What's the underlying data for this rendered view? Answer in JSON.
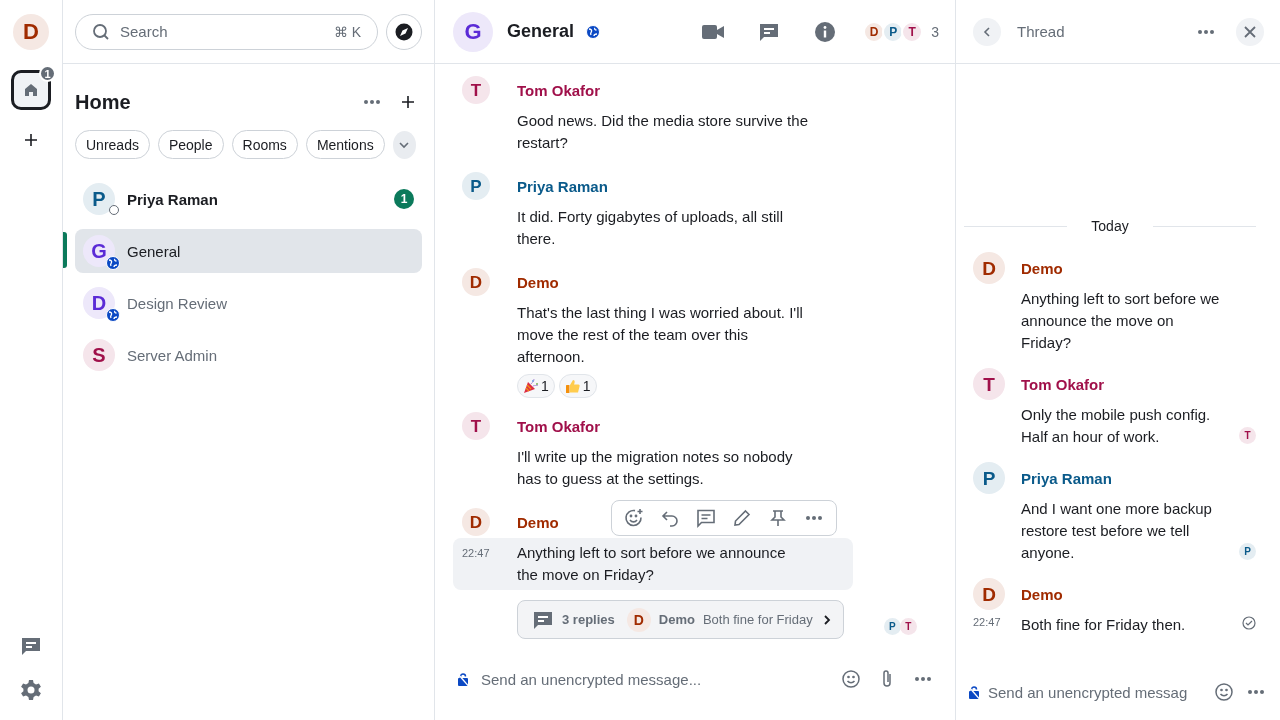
{
  "spaces": {
    "user": {
      "initial": "D",
      "color": "#a02b00"
    },
    "home": {
      "badge": "1",
      "selected": true
    }
  },
  "room_list": {
    "search": {
      "placeholder": "Search",
      "shortcut": "⌘ K"
    },
    "title": "Home",
    "filters": [
      {
        "label": "Unreads",
        "selected": false
      },
      {
        "label": "People",
        "selected": false
      },
      {
        "label": "Rooms",
        "selected": false
      },
      {
        "label": "Mentions",
        "selected": false
      }
    ],
    "rooms": [
      {
        "initial": "P",
        "name": "Priya Raman",
        "color": "#0a5a8a",
        "kind": "dm",
        "unread": true,
        "badge": "1",
        "selected": false
      },
      {
        "initial": "G",
        "name": "General",
        "color": "#5b2bd6",
        "kind": "public",
        "unread": false,
        "selected": true
      },
      {
        "initial": "D",
        "name": "Design Review",
        "color": "#5b2bd6",
        "kind": "public",
        "unread": false,
        "selected": false
      },
      {
        "initial": "S",
        "name": "Server Admin",
        "color": "#a0104a",
        "kind": "private",
        "unread": false,
        "selected": false
      }
    ]
  },
  "room": {
    "initial": "G",
    "name": "General",
    "color": "#5b2bd6",
    "public": true,
    "members": [
      {
        "initial": "D",
        "color": "#a02b00"
      },
      {
        "initial": "P",
        "color": "#0a5a8a"
      },
      {
        "initial": "T",
        "color": "#a0104a"
      }
    ],
    "member_count": "3",
    "messages": [
      {
        "sender": "Tom Okafor",
        "initial": "T",
        "color": "#a0104a",
        "body": "Good news. Did the media store survive the restart?",
        "hovered": false
      },
      {
        "sender": "Priya Raman",
        "initial": "P",
        "color": "#0a5a8a",
        "body": "It did. Forty gigabytes of uploads, all still there.",
        "hovered": false
      },
      {
        "sender": "Demo",
        "initial": "D",
        "color": "#a02b00",
        "body": "That's the last thing I was worried about. I'll move the rest of the team over this afternoon.",
        "hovered": false,
        "reactions": [
          {
            "kind": "party",
            "count": "1"
          },
          {
            "kind": "thumbs_up",
            "count": "1"
          }
        ]
      },
      {
        "sender": "Tom Okafor",
        "initial": "T",
        "color": "#a0104a",
        "body": "I'll write up the migration notes so nobody has to guess at the settings.",
        "hovered": false
      },
      {
        "sender": "Demo",
        "initial": "D",
        "color": "#a02b00",
        "time": "22:47",
        "body": "Anything left to sort before we announce the move on Friday?",
        "hovered": true,
        "thread": {
          "replies": "3 replies",
          "initial": "D",
          "color": "#a02b00",
          "sender": "Demo",
          "preview": "Both fine for Friday"
        },
        "receipts": [
          {
            "initial": "P",
            "color": "#0a5a8a"
          },
          {
            "initial": "T",
            "color": "#a0104a"
          }
        ]
      }
    ],
    "composer": {
      "placeholder": "Send an unencrypted message..."
    }
  },
  "thread": {
    "title": "Thread",
    "date": "Today",
    "messages": [
      {
        "sender": "Demo",
        "initial": "D",
        "color": "#a02b00",
        "body": "Anything left to sort before we announce the move on Friday?",
        "sent": false
      },
      {
        "sender": "Tom Okafor",
        "initial": "T",
        "color": "#a0104a",
        "body": "Only the mobile push config. Half an hour of work.",
        "sent": false,
        "receipts": [
          {
            "initial": "T",
            "color": "#a0104a"
          }
        ]
      },
      {
        "sender": "Priya Raman",
        "initial": "P",
        "color": "#0a5a8a",
        "body": "And I want one more backup restore test before we tell anyone.",
        "sent": false,
        "receipts": [
          {
            "initial": "P",
            "color": "#0a5a8a"
          }
        ]
      },
      {
        "sender": "Demo",
        "initial": "D",
        "color": "#a02b00",
        "time": "22:47",
        "body": "Both fine for Friday then.",
        "sent": true
      }
    ],
    "composer": {
      "placeholder": "Send an unencrypted messag"
    }
  }
}
